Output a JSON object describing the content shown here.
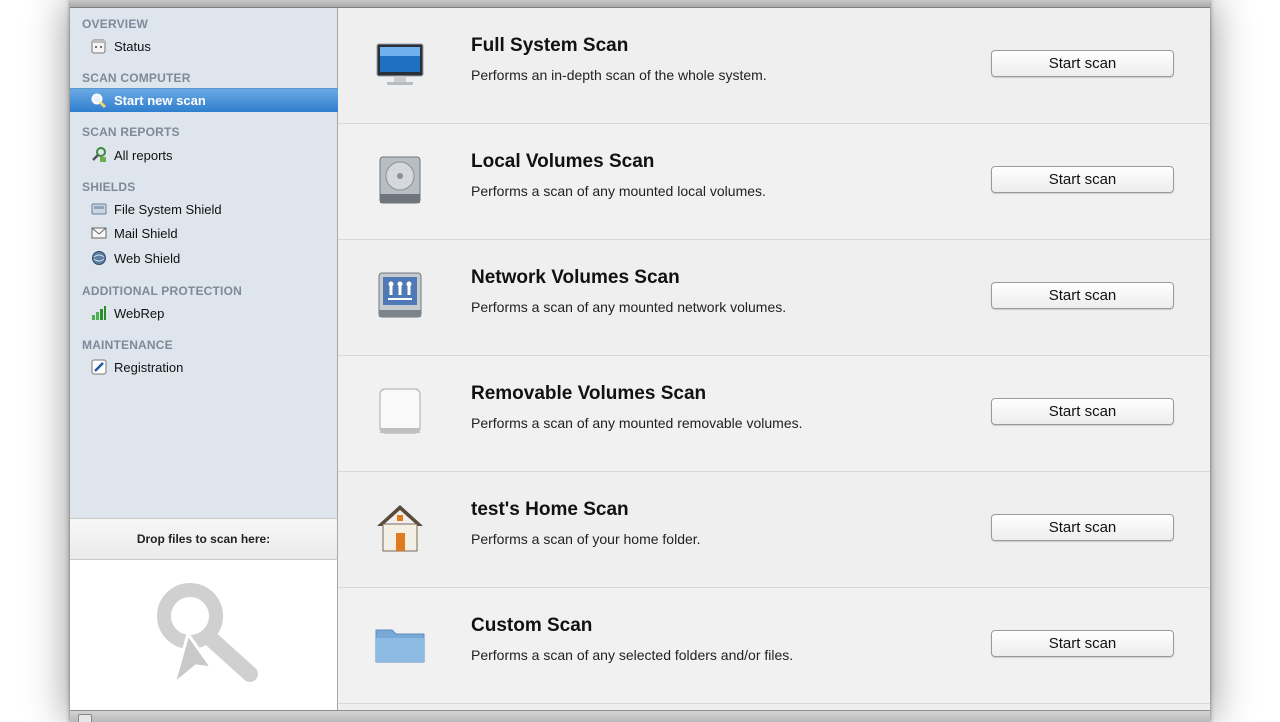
{
  "sidebar": {
    "sections": [
      {
        "title": "OVERVIEW"
      },
      {
        "title": "SCAN COMPUTER"
      },
      {
        "title": "SCAN REPORTS"
      },
      {
        "title": "SHIELDS"
      },
      {
        "title": "ADDITIONAL PROTECTION"
      },
      {
        "title": "MAINTENANCE"
      }
    ],
    "items": [
      {
        "label": "Status",
        "icon": "calendar-icon"
      },
      {
        "label": "Start new scan",
        "icon": "magnifier-icon",
        "selected": true
      },
      {
        "label": "All reports",
        "icon": "reports-icon"
      },
      {
        "label": "File System Shield",
        "icon": "file-system-shield-icon"
      },
      {
        "label": "Mail Shield",
        "icon": "mail-shield-icon"
      },
      {
        "label": "Web Shield",
        "icon": "web-shield-icon"
      },
      {
        "label": "WebRep",
        "icon": "webrep-bars-icon"
      },
      {
        "label": "Registration",
        "icon": "pencil-icon"
      }
    ]
  },
  "dropzone": {
    "label": "Drop files to scan here:",
    "icon": "drop-scan-icon"
  },
  "scans": [
    {
      "title": "Full System Scan",
      "description": "Performs an in-depth scan of the whole system.",
      "button": "Start scan",
      "icon": "computer-monitor-icon"
    },
    {
      "title": "Local Volumes Scan",
      "description": "Performs a scan of any mounted local volumes.",
      "button": "Start scan",
      "icon": "hard-drive-icon"
    },
    {
      "title": "Network Volumes Scan",
      "description": "Performs a scan of any mounted network volumes.",
      "button": "Start scan",
      "icon": "network-drive-icon"
    },
    {
      "title": "Removable Volumes Scan",
      "description": "Performs a scan of any mounted removable volumes.",
      "button": "Start scan",
      "icon": "removable-drive-icon"
    },
    {
      "title": "test's Home Scan",
      "description": "Performs a scan of your home folder.",
      "button": "Start scan",
      "icon": "home-icon"
    },
    {
      "title": "Custom Scan",
      "description": "Performs a scan of any selected folders and/or files.",
      "button": "Start scan",
      "icon": "folder-icon"
    }
  ],
  "colors": {
    "selection": "#2f7fcf",
    "sidebar_bg": "#dfe5ed",
    "section_title": "#7e8a98"
  }
}
